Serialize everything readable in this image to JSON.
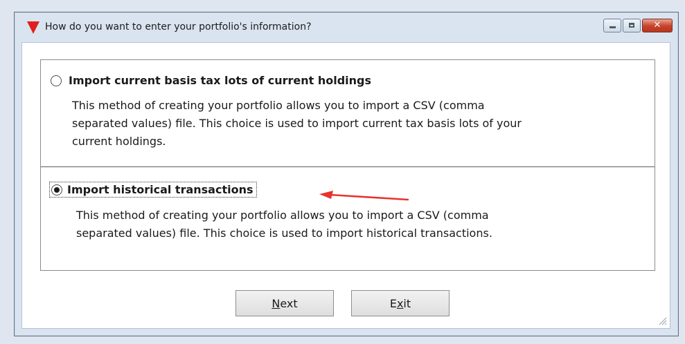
{
  "window": {
    "title": "How do you want to enter your portfolio's information?",
    "icons": {
      "app": "red-triangle-icon",
      "minimize": "minimize-icon",
      "maximize": "maximize-icon",
      "close": "close-icon"
    },
    "close_glyph": "✕"
  },
  "options": [
    {
      "label": "Import current basis tax lots of current holdings",
      "selected": false,
      "description_lines": [
        "This method of creating your portfolio allows you to import a CSV (comma",
        "separated values) file.  This choice is used to import current tax basis lots of your",
        "current holdings."
      ]
    },
    {
      "label": "Import historical transactions",
      "selected": true,
      "description_lines": [
        "This method of creating your portfolio allows you to import a CSV (comma",
        "separated values) file.  This choice is used to import historical transactions."
      ]
    }
  ],
  "annotation": {
    "icon": "red-arrow-icon",
    "color": "#e8332e"
  },
  "buttons": {
    "next": {
      "mnemonic": "N",
      "rest": "ext"
    },
    "exit": {
      "prefix": "E",
      "mnemonic": "x",
      "rest": "it"
    }
  },
  "colors": {
    "accent_red": "#e0201c",
    "close_button": "#c7422a"
  }
}
